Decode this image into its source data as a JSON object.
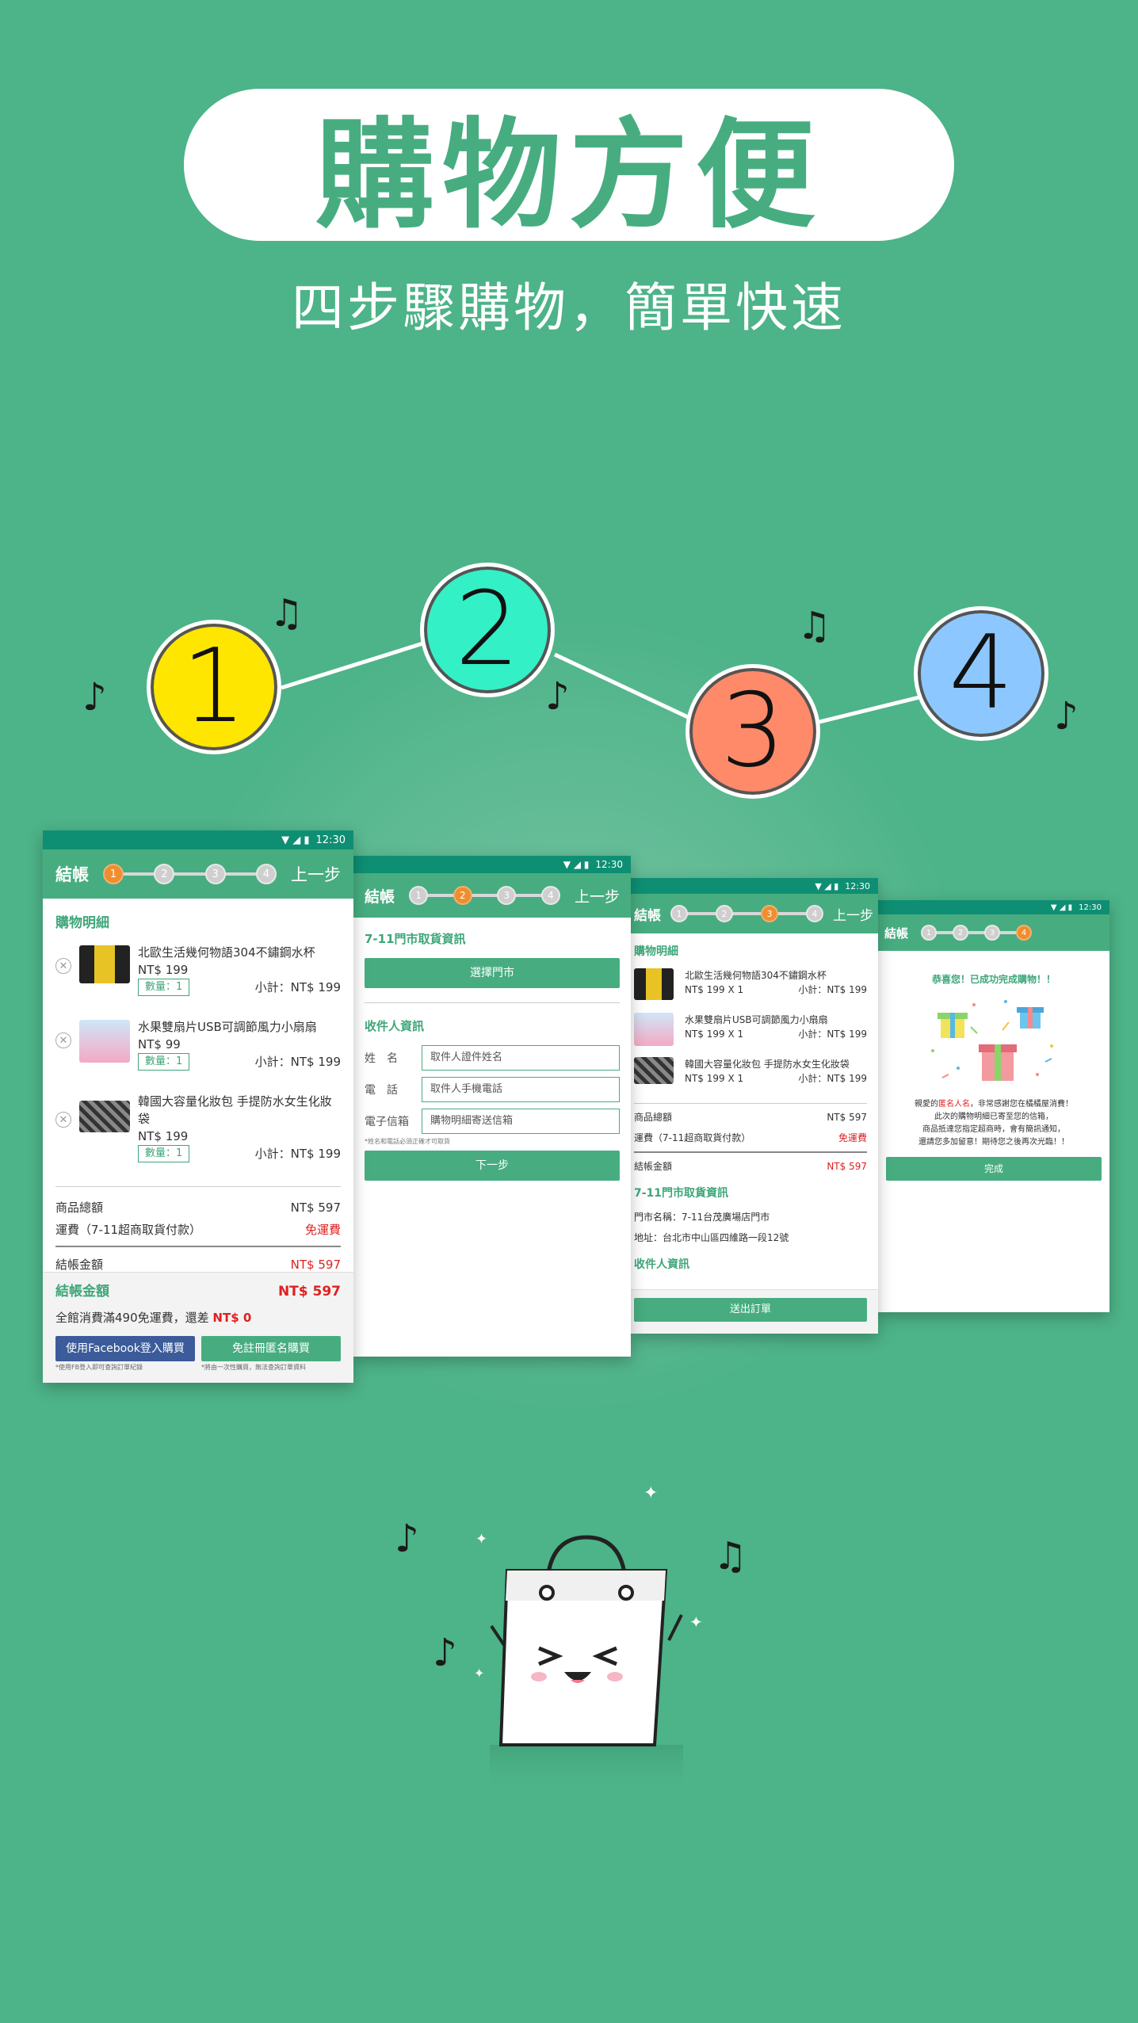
{
  "header": {
    "title": "購物方便",
    "subtitle": "四步驟購物，簡單快速"
  },
  "steps": [
    {
      "num": "1",
      "color": "#ffe600"
    },
    {
      "num": "2",
      "color": "#33f0c6"
    },
    {
      "num": "3",
      "color": "#ff8a6a"
    },
    {
      "num": "4",
      "color": "#8cc8ff"
    }
  ],
  "notes": {
    "eighth": "♪",
    "beamed": "♫"
  },
  "status": {
    "time": "12:30",
    "icons": "▼ ◢ ▮"
  },
  "screens": {
    "s1": {
      "title": "結帳",
      "back": "上一步",
      "section": "購物明細",
      "items": [
        {
          "name": "北歐生活幾何物語304不鏽鋼水杯",
          "price": "NT$ 199",
          "qty": "數量：1",
          "subtotal": "小計：NT$ 199"
        },
        {
          "name": "水果雙扇片USB可調節風力小扇扇",
          "price": "NT$ 99",
          "qty": "數量：1",
          "subtotal": "小計：NT$ 199"
        },
        {
          "name": "韓國大容量化妝包 手提防水女生化妝袋",
          "price": "NT$ 199",
          "qty": "數量：1",
          "subtotal": "小計：NT$ 199"
        }
      ],
      "goods_total_label": "商品總額",
      "goods_total": "NT$ 597",
      "shipping_label": "運費（7-11超商取貨付款）",
      "shipping": "免運費",
      "checkout_label": "結帳金額",
      "checkout": "NT$ 597",
      "summary_label": "結帳金額",
      "summary": "NT$ 597",
      "free_ship_note": "全館消費滿490免運費，還差",
      "free_ship_diff": "NT$ 0",
      "fb_button": "使用Facebook登入購買",
      "guest_button": "免註冊匿名購買",
      "fb_note": "*使用FB登入即可查詢訂單紀錄",
      "guest_note": "*將由一次性購買，無法查詢訂單資料"
    },
    "s2": {
      "title": "結帳",
      "back": "上一步",
      "store_section": "7-11門市取貨資訊",
      "select_store": "選擇門市",
      "receiver_section": "收件人資訊",
      "fields": [
        {
          "label": "姓　名",
          "placeholder": "取件人證件姓名"
        },
        {
          "label": "電　話",
          "placeholder": "取件人手機電話"
        },
        {
          "label": "電子信箱",
          "placeholder": "購物明細寄送信箱"
        }
      ],
      "note": "*姓名和電話必須正確才可取貨",
      "next": "下一步"
    },
    "s3": {
      "title": "結帳",
      "back": "上一步",
      "section": "購物明細",
      "items": [
        {
          "name": "北歐生活幾何物語304不鏽鋼水杯",
          "price": "NT$ 199 X 1",
          "subtotal": "小計：NT$ 199"
        },
        {
          "name": "水果雙扇片USB可調節風力小扇扇",
          "price": "NT$ 199 X 1",
          "subtotal": "小計：NT$ 199"
        },
        {
          "name": "韓國大容量化妝包 手提防水女生化妝袋",
          "price": "NT$ 199 X 1",
          "subtotal": "小計：NT$ 199"
        }
      ],
      "goods_total_label": "商品總額",
      "goods_total": "NT$ 597",
      "shipping_label": "運費（7-11超商取貨付款）",
      "shipping": "免運費",
      "checkout_label": "結帳金額",
      "checkout": "NT$ 597",
      "store_section": "7-11門市取貨資訊",
      "store_name": "門市名稱：7-11台茂廣場店門市",
      "store_addr": "地址：台北市中山區四維路一段12號",
      "receiver_section": "收件人資訊",
      "submit": "送出訂單"
    },
    "s4": {
      "title": "結帳",
      "done_title": "恭喜您！已成功完成購物！！",
      "msg1_pre": "親愛的",
      "msg1_hl": "匿名人名",
      "msg1_post": "，非常感謝您在橘橘屋消費！",
      "msg2": "此次的購物明細已寄至您的信箱，",
      "msg3": "商品抵達您指定超商時，會有簡訊通知，",
      "msg4": "還請您多加留意！期待您之後再次光臨！！",
      "done_button": "完成"
    }
  }
}
